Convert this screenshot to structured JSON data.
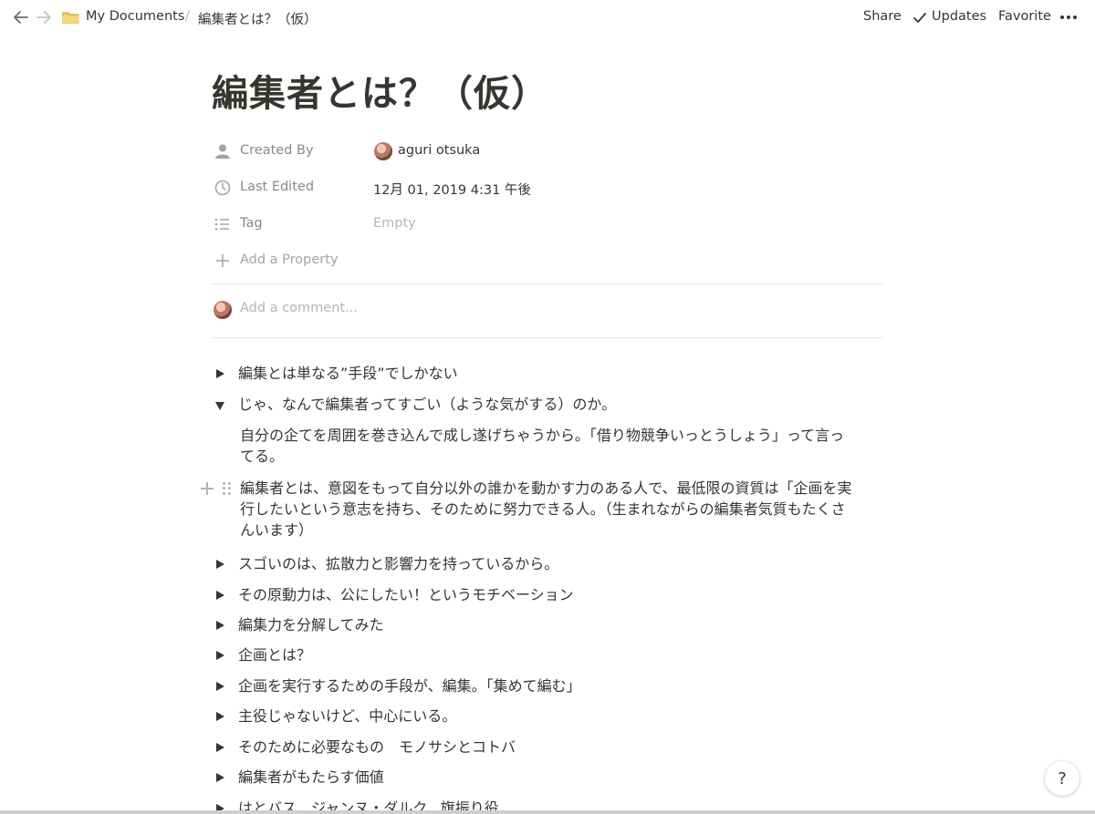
{
  "breadcrumb": {
    "workspace": "My Documents",
    "separator": "/",
    "page": "編集者とは？（仮）"
  },
  "topbar": {
    "share": "Share",
    "updates": "Updates",
    "favorite": "Favorite"
  },
  "page": {
    "title": "編集者とは？（仮）"
  },
  "properties": {
    "created_by": {
      "label": "Created By",
      "value": "aguri otsuka"
    },
    "last_edited": {
      "label": "Last Edited",
      "value": "12月 01, 2019 4:31 午後"
    },
    "tag": {
      "label": "Tag",
      "value": "Empty"
    },
    "add_property": "Add a Property"
  },
  "comment": {
    "placeholder": "Add a comment..."
  },
  "blocks": [
    {
      "text": "編集とは単なる”手段”でしかない"
    },
    {
      "text": "じゃ、なんで編集者ってすごい（ような気がする）のか。"
    },
    {
      "text": "スゴいのは、拡散力と影響力を持っているから。"
    },
    {
      "text": "その原動力は、公にしたい！というモチベーション"
    },
    {
      "text": "編集力を分解してみた"
    },
    {
      "text": "企画とは？"
    },
    {
      "text": "企画を実行するための手段が、編集。「集めて編む」"
    },
    {
      "text": "主役じゃないけど、中心にいる。"
    },
    {
      "text": "そのために必要なもの　モノサシとコトバ"
    },
    {
      "text": "編集者がもたらす価値"
    },
    {
      "text": "はとバス、ジャンヌ・ダルク、旗振り役"
    }
  ],
  "paragraphs": {
    "p1": [
      "自分の企てを周囲を巻き込んで成し遂げちゃうから。「借り物競争いっとうしょう」って言っ",
      "てる。"
    ],
    "p2": [
      "編集者とは、意図をもって自分以外の誰かを動かす力のある人で、最低限の資質は「企画を実",
      "行したいという意志を持ち、そのために努力できる人。（生まれながらの編集者気質もたくさ",
      "んいます）"
    ]
  },
  "help": "?",
  "colors": {
    "text": "#37352f",
    "muted": "#8a8985",
    "placeholder": "#b4b4b0"
  }
}
